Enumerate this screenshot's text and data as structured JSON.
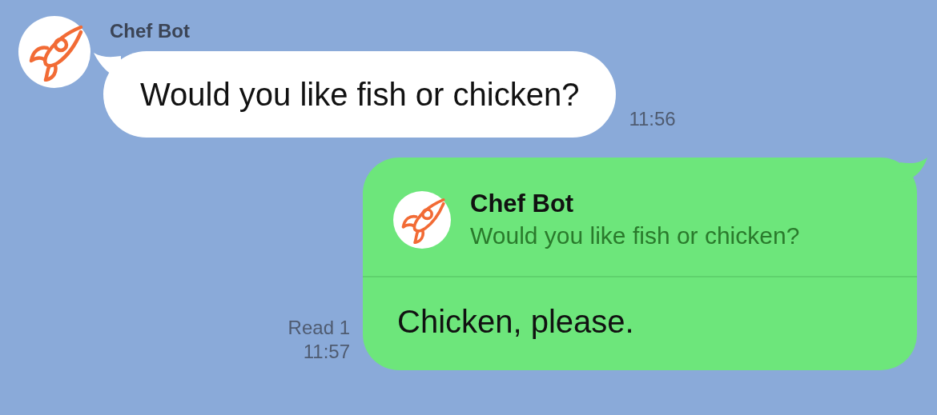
{
  "messages": [
    {
      "kind": "incoming",
      "sender": "Chef Bot",
      "text": "Would you like fish or chicken?",
      "time": "11:56"
    },
    {
      "kind": "outgoing",
      "quote": {
        "sender": "Chef Bot",
        "text": "Would you like fish or chicken?"
      },
      "text": "Chicken, please.",
      "read_status": "Read 1",
      "time": "11:57"
    }
  ]
}
